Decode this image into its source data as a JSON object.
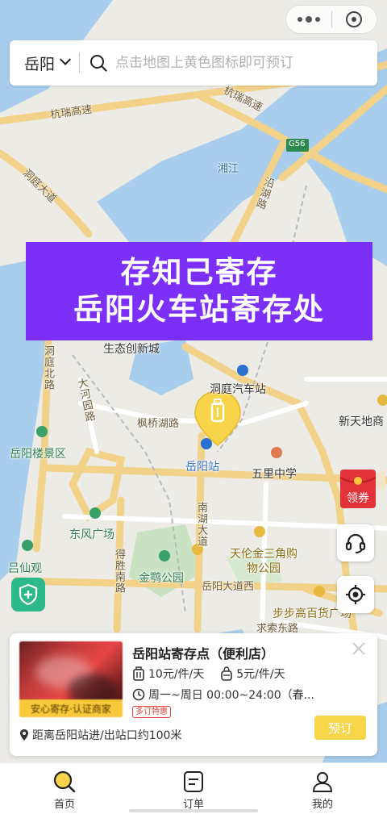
{
  "top_capsule": {
    "more_icon": "more-dots-icon",
    "close_icon": "target-circle-icon"
  },
  "search": {
    "city": "岳阳",
    "placeholder": "点击地图上黄色图标即可预订"
  },
  "banner": {
    "line1": "存知己寄存",
    "line2": "岳阳火车站寄存处",
    "color": "#7b2ff7"
  },
  "map": {
    "labels": {
      "hangrui": "杭瑞高速",
      "hangrui2": "杭瑞高速",
      "g56": "G56",
      "xiangjiang": "湘江",
      "dongting_ave": "洞庭大道",
      "yanhu_rd": "沿湖路",
      "shengtai": "生态创新城",
      "dongting_north": "洞庭北路",
      "dongting_bus": "洞庭汽车站",
      "dahe_yuan": "大河园路",
      "fengqiao": "枫桥湖路",
      "xintian": "新天地商",
      "yueyanglou": "岳阳楼景区",
      "yueyang_station": "岳阳站",
      "wuli_school": "五里中学",
      "nanhu": "南湖大道",
      "dongfeng": "东风广场",
      "lvxian": "吕仙观",
      "desheng": "得胜南路",
      "tianlun": "天伦金三角购物公园",
      "jinyan": "金鹗公园",
      "yueyang_ave": "岳阳大道西",
      "bubugao": "步步高百货广场",
      "qiusuo": "求索东路"
    },
    "accent": "#f0c33c"
  },
  "coupon": {
    "label": "领券",
    "color": "#e2333a"
  },
  "store": {
    "name": "岳阳站寄存点（便利店）",
    "badge": "安心寄存·认证商家",
    "price_large": "10元/件/天",
    "price_small": "5元/件/天",
    "hours": "周一~周日 00:00~24:00（春...",
    "tag": "多订特惠",
    "distance": "距离岳阳站进/出站口约100米",
    "book_label": "预订"
  },
  "tabs": [
    {
      "label": "首页",
      "icon": "search-icon"
    },
    {
      "label": "订单",
      "icon": "order-icon"
    },
    {
      "label": "我的",
      "icon": "user-icon"
    }
  ]
}
